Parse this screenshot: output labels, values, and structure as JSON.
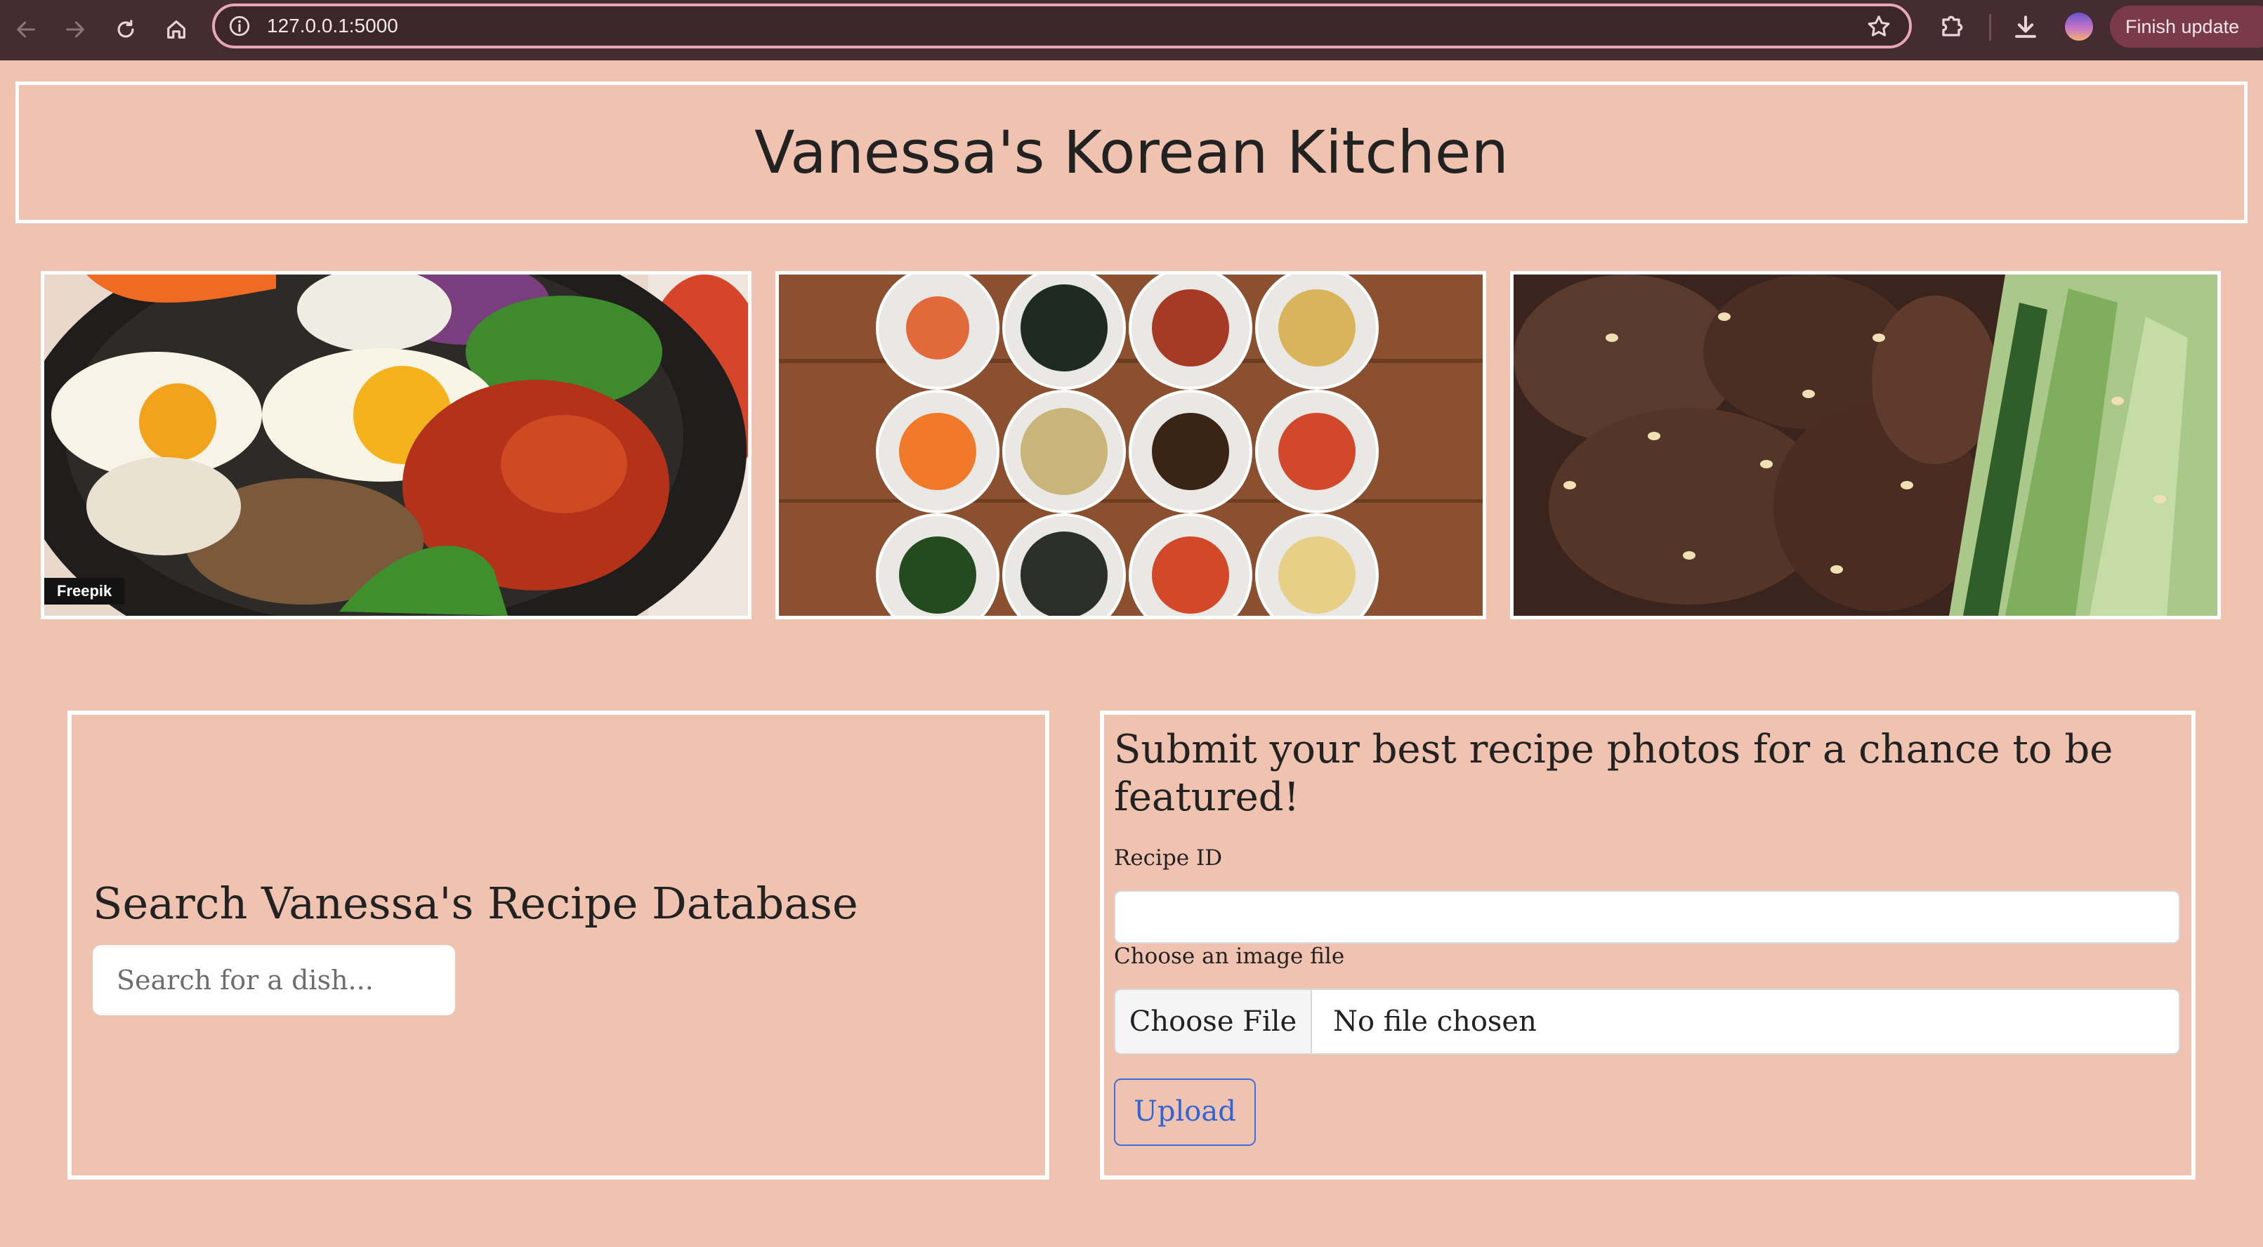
{
  "browser": {
    "url": "127.0.0.1:5000",
    "update_label": "Finish update",
    "menu_glyph": "⋮",
    "icons": [
      "back-arrow-icon",
      "forward-arrow-icon",
      "reload-icon",
      "home-icon",
      "site-info-icon",
      "bookmark-star-icon",
      "extensions-icon",
      "download-icon",
      "profile-avatar"
    ]
  },
  "page": {
    "title": "Vanessa's Korean Kitchen",
    "photos": [
      {
        "subject": "bibimbap",
        "credit": "Freepik"
      },
      {
        "subject": "banchan"
      },
      {
        "subject": "bulgogi"
      }
    ],
    "search": {
      "heading": "Search Vanessa's Recipe Database",
      "placeholder": "Search for a dish..."
    },
    "upload": {
      "heading": "Submit your best recipe photos for a chance to be featured!",
      "recipe_id_label": "Recipe ID",
      "image_label": "Choose an image file",
      "choose_file_label": "Choose File",
      "no_file_text": "No file chosen",
      "upload_label": "Upload"
    }
  },
  "colors": {
    "page_background": "#f0c3b1",
    "chrome_background": "#452c33",
    "border": "#ffffff",
    "upload_accent": "#2f64d6"
  }
}
